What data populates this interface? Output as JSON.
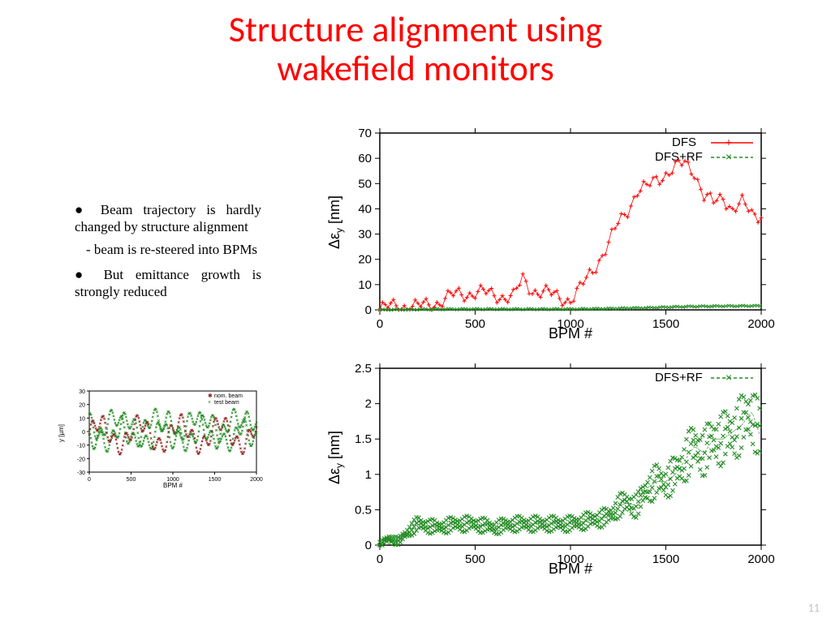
{
  "title": {
    "line1": "Structure alignment using",
    "line2": "wakefield monitors"
  },
  "bullets": {
    "b1": "Beam trajectory is hardly changed by structure alignment",
    "b1sub": "beam is re-steered into BPMs",
    "b2": "But emittance growth is strongly reduced"
  },
  "page": "11",
  "mini": {
    "xlabel": "BPM #",
    "ylabel": "y [µm]",
    "legend": [
      "nom. beam",
      "test beam"
    ],
    "xlim": [
      0,
      2000
    ],
    "ylim": [
      -30,
      30
    ],
    "xticks": [
      0,
      500,
      1000,
      1500,
      2000
    ],
    "yticks": [
      -30,
      -20,
      -10,
      0,
      10,
      20,
      30
    ]
  },
  "top": {
    "xlabel": "BPM #",
    "ylabel": "Δε_y [nm]",
    "legend": [
      "DFS",
      "DFS+RF"
    ],
    "xlim": [
      0,
      2000
    ],
    "ylim": [
      0,
      70
    ],
    "xticks": [
      0,
      500,
      1000,
      1500,
      2000
    ],
    "yticks": [
      0,
      10,
      20,
      30,
      40,
      50,
      60,
      70
    ]
  },
  "bottom": {
    "xlabel": "BPM #",
    "ylabel": "Δε_y [nm]",
    "legend": [
      "DFS+RF"
    ],
    "xlim": [
      0,
      2000
    ],
    "ylim": [
      0,
      2.5
    ],
    "xticks": [
      0,
      500,
      1000,
      1500,
      2000
    ],
    "yticks": [
      0,
      0.5,
      1,
      1.5,
      2,
      2.5
    ]
  },
  "chart_data": [
    {
      "type": "scatter",
      "title": "Beam trajectory before/after",
      "xlabel": "BPM #",
      "ylabel": "y [µm]",
      "xlim": [
        0,
        2000
      ],
      "ylim": [
        -30,
        30
      ],
      "series": [
        {
          "name": "nom. beam",
          "color": "#8b1a1a",
          "marker": "*",
          "note": "dense noisy band roughly -15..15 across full range"
        },
        {
          "name": "test beam",
          "color": "#228b22",
          "marker": "x",
          "note": "dense noisy band roughly -15..15 across full range, overlapping nom. beam"
        }
      ]
    },
    {
      "type": "line+scatter",
      "title": "Emittance growth DFS vs DFS+RF",
      "xlabel": "BPM #",
      "ylabel": "Δε_y [nm]",
      "xlim": [
        0,
        2000
      ],
      "ylim": [
        0,
        70
      ],
      "series": [
        {
          "name": "DFS",
          "color": "#ff0000",
          "marker": "+",
          "x": [
            0,
            100,
            200,
            300,
            400,
            500,
            600,
            700,
            750,
            800,
            900,
            1000,
            1050,
            1100,
            1150,
            1200,
            1250,
            1300,
            1350,
            1400,
            1450,
            1500,
            1550,
            1600,
            1650,
            1700,
            1750,
            1800,
            1850,
            1900,
            1950,
            2000
          ],
          "values": [
            0,
            2,
            1,
            3,
            6,
            7,
            6,
            5,
            12,
            8,
            6,
            4,
            8,
            14,
            20,
            26,
            34,
            40,
            47,
            48,
            52,
            54,
            56,
            58,
            55,
            45,
            42,
            45,
            40,
            42,
            38,
            38
          ]
        },
        {
          "name": "DFS+RF",
          "color": "#228b22",
          "marker": "x",
          "x": [
            0,
            200,
            400,
            600,
            800,
            1000,
            1200,
            1400,
            1600,
            1800,
            2000
          ],
          "values": [
            0,
            0.2,
            0.3,
            0.3,
            0.3,
            0.3,
            0.5,
            0.8,
            1.3,
            1.5,
            1.6
          ]
        }
      ]
    },
    {
      "type": "line+scatter",
      "title": "Emittance growth DFS+RF (zoom)",
      "xlabel": "BPM #",
      "ylabel": "Δε_y [nm]",
      "xlim": [
        0,
        2000
      ],
      "ylim": [
        0,
        2.5
      ],
      "series": [
        {
          "name": "DFS+RF",
          "color": "#228b22",
          "marker": "x",
          "x": [
            0,
            50,
            100,
            150,
            200,
            300,
            400,
            500,
            600,
            700,
            800,
            900,
            1000,
            1100,
            1200,
            1250,
            1300,
            1350,
            1400,
            1450,
            1500,
            1550,
            1600,
            1650,
            1700,
            1750,
            1800,
            1850,
            1900,
            1950,
            2000
          ],
          "values": [
            0,
            0.1,
            0.05,
            0.2,
            0.3,
            0.25,
            0.3,
            0.3,
            0.25,
            0.3,
            0.3,
            0.3,
            0.3,
            0.35,
            0.4,
            0.55,
            0.6,
            0.55,
            0.8,
            0.9,
            0.9,
            1.0,
            1.2,
            1.4,
            1.3,
            1.5,
            1.5,
            1.6,
            1.7,
            1.9,
            1.5
          ]
        }
      ]
    }
  ]
}
